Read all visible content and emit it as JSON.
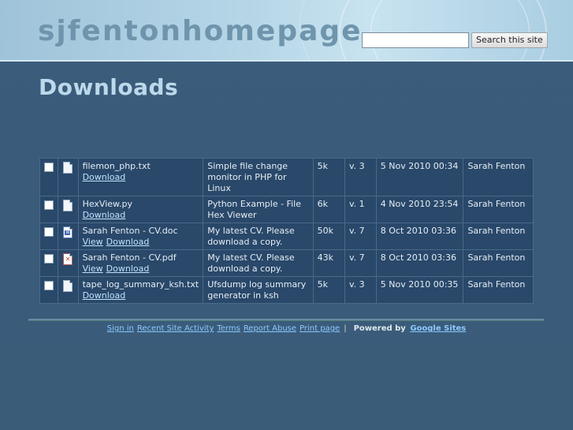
{
  "header": {
    "site_title": "sjfentonhomepage",
    "search": {
      "placeholder": "",
      "value": "",
      "button_label": "Search this site"
    }
  },
  "page": {
    "title": "Downloads"
  },
  "files": [
    {
      "icon": "text-file-icon",
      "name": "filemon_php.txt",
      "links": [
        "Download"
      ],
      "description": "Simple file change monitor in PHP for Linux",
      "size": "5k",
      "version": "v. 3",
      "date": "5 Nov 2010 00:34",
      "author": "Sarah Fenton"
    },
    {
      "icon": "text-file-icon",
      "name": "HexView.py",
      "links": [
        "Download"
      ],
      "description": "Python Example - File Hex Viewer",
      "size": "6k",
      "version": "v. 1",
      "date": "4 Nov 2010 23:54",
      "author": "Sarah Fenton"
    },
    {
      "icon": "word-document-icon",
      "name": "Sarah Fenton - CV.doc",
      "links": [
        "View",
        "Download"
      ],
      "description": "My latest CV. Please download a copy.",
      "size": "50k",
      "version": "v. 7",
      "date": "8 Oct 2010 03:36",
      "author": "Sarah Fenton"
    },
    {
      "icon": "pdf-document-icon",
      "name": "Sarah Fenton - CV.pdf",
      "links": [
        "View",
        "Download"
      ],
      "description": "My latest CV. Please download a copy.",
      "size": "43k",
      "version": "v. 7",
      "date": "8 Oct 2010 03:36",
      "author": "Sarah Fenton"
    },
    {
      "icon": "text-file-icon",
      "name": "tape_log_summary_ksh.txt",
      "links": [
        "Download"
      ],
      "description": "Ufsdump log summary generator in ksh",
      "size": "5k",
      "version": "v. 3",
      "date": "5 Nov 2010 00:35",
      "author": "Sarah Fenton"
    }
  ],
  "footer": {
    "links": [
      "Sign in",
      "Recent Site Activity",
      "Terms",
      "Report Abuse",
      "Print page"
    ],
    "separator": "|",
    "powered_by": "Powered by",
    "powered_by_link": "Google Sites"
  },
  "colors": {
    "background": "#3a5c7a",
    "table_cell": "#29486a",
    "title": "#bcd8ea",
    "link": "#bfe2ff"
  }
}
